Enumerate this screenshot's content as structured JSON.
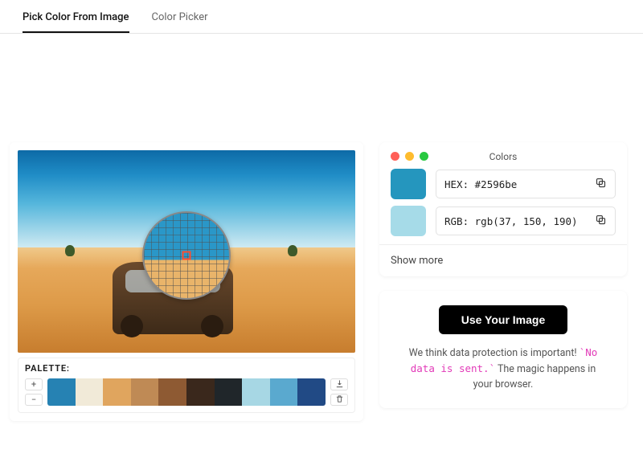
{
  "tabs": {
    "pick": "Pick Color From Image",
    "picker": "Color Picker"
  },
  "palette": {
    "label": "PALETTE:",
    "plus": "+",
    "minus": "−",
    "colors": [
      "#2682b3",
      "#f1ead8",
      "#e0a55e",
      "#bf8a55",
      "#8e5a33",
      "#3a281c",
      "#20262a",
      "#a7d7e4",
      "#5aa9cf",
      "#214a85"
    ]
  },
  "colors_panel": {
    "title": "Colors",
    "primary_swatch": "#2596be",
    "secondary_swatch": "#a6dbe8",
    "hex_label": "HEX:",
    "hex_value": "#2596be",
    "rgb_label": "RGB:",
    "rgb_value": "rgb(37, 150, 190)",
    "show_more": "Show more"
  },
  "cta": {
    "button": "Use Your Image",
    "line1_a": "We think data protection is important! ",
    "line1_b": "`No data is sent.`",
    "line1_c": " The magic happens in your browser."
  }
}
